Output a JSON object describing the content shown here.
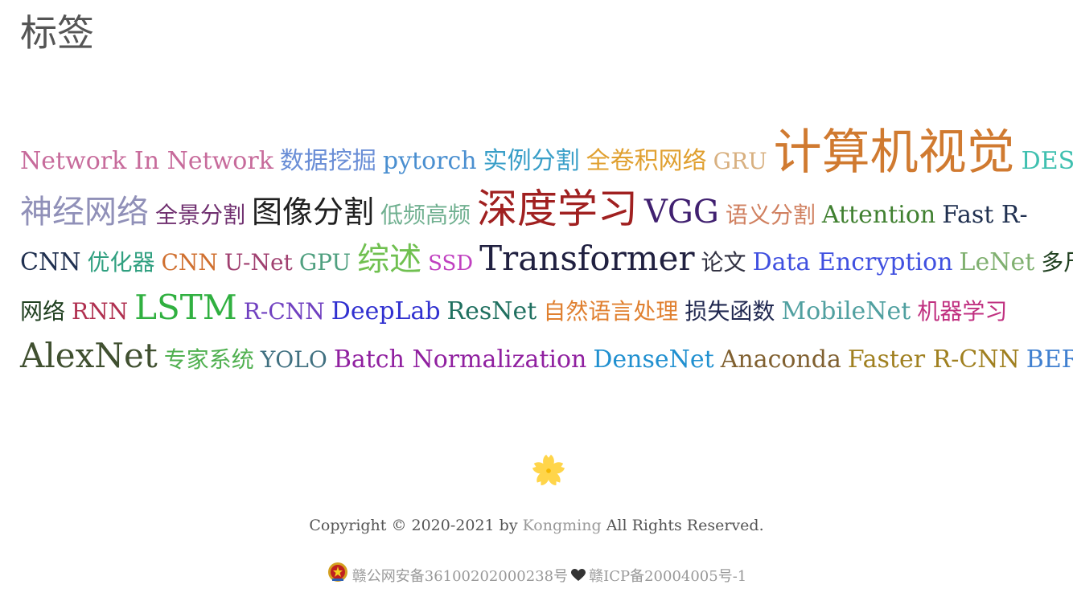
{
  "page": {
    "title": "标签"
  },
  "tags": [
    [
      {
        "label": "Network In Network",
        "size": 30,
        "color": "#c76b9b"
      },
      {
        "label": "数据挖掘",
        "size": 30,
        "color": "#6a8ed6"
      },
      {
        "label": "pytorch",
        "size": 30,
        "color": "#4a8fd0"
      },
      {
        "label": "实例分割",
        "size": 30,
        "color": "#3a9fc8"
      },
      {
        "label": "全卷积网络",
        "size": 30,
        "color": "#e0a030"
      },
      {
        "label": "GRU",
        "size": 28,
        "color": "#d8b080"
      },
      {
        "label": "计算机视觉",
        "size": 60,
        "color": "#d07a30"
      },
      {
        "label": "DES",
        "size": 30,
        "color": "#40c0b0"
      }
    ],
    [
      {
        "label": "神经网络",
        "size": 40,
        "color": "#9090b8"
      },
      {
        "label": "全景分割",
        "size": 28,
        "color": "#703070"
      },
      {
        "label": "图像分割",
        "size": 38,
        "color": "#202020"
      },
      {
        "label": "低频高频",
        "size": 28,
        "color": "#70b090"
      },
      {
        "label": "深度学习",
        "size": 50,
        "color": "#a02020"
      },
      {
        "label": "VGG",
        "size": 40,
        "color": "#402070"
      },
      {
        "label": "语义分割",
        "size": 28,
        "color": "#d08060"
      },
      {
        "label": "Attention",
        "size": 30,
        "color": "#408030"
      },
      {
        "label": "Fast R-",
        "size": 30,
        "color": "#203050"
      }
    ],
    [
      {
        "label": "CNN",
        "size": 30,
        "color": "#203050"
      },
      {
        "label": "优化器",
        "size": 28,
        "color": "#30a080"
      },
      {
        "label": "CNN",
        "size": 28,
        "color": "#d07030"
      },
      {
        "label": "U-Net",
        "size": 28,
        "color": "#a04070"
      },
      {
        "label": "GPU",
        "size": 28,
        "color": "#50a080"
      },
      {
        "label": "综述",
        "size": 40,
        "color": "#70c050"
      },
      {
        "label": "SSD",
        "size": 26,
        "color": "#c040c0"
      },
      {
        "label": "Transformer",
        "size": 42,
        "color": "#202040"
      },
      {
        "label": "论文",
        "size": 28,
        "color": "#303040"
      },
      {
        "label": "Data Encryption",
        "size": 30,
        "color": "#4050e0"
      },
      {
        "label": "LeNet",
        "size": 30,
        "color": "#80b070"
      },
      {
        "label": "多尺度",
        "size": 28,
        "color": "#204020"
      }
    ],
    [
      {
        "label": "网络",
        "size": 28,
        "color": "#204020"
      },
      {
        "label": "RNN",
        "size": 28,
        "color": "#b03050"
      },
      {
        "label": "LSTM",
        "size": 42,
        "color": "#30b040"
      },
      {
        "label": "R-CNN",
        "size": 28,
        "color": "#7040c0"
      },
      {
        "label": "DeepLab",
        "size": 30,
        "color": "#3030d0"
      },
      {
        "label": "ResNet",
        "size": 30,
        "color": "#207060"
      },
      {
        "label": "自然语言处理",
        "size": 28,
        "color": "#e08030"
      },
      {
        "label": "损失函数",
        "size": 28,
        "color": "#202850"
      },
      {
        "label": "MobileNet",
        "size": 30,
        "color": "#50a0a0"
      },
      {
        "label": "机器学习",
        "size": 28,
        "color": "#c03080"
      }
    ],
    [
      {
        "label": "AlexNet",
        "size": 42,
        "color": "#405030"
      },
      {
        "label": "专家系统",
        "size": 28,
        "color": "#50b050"
      },
      {
        "label": "YOLO",
        "size": 28,
        "color": "#407080"
      },
      {
        "label": "Batch Normalization",
        "size": 30,
        "color": "#9020a0"
      },
      {
        "label": "DenseNet",
        "size": 30,
        "color": "#2090d0"
      },
      {
        "label": "Anaconda",
        "size": 30,
        "color": "#806030"
      },
      {
        "label": "Faster R-CNN",
        "size": 30,
        "color": "#a08020"
      },
      {
        "label": "BERT",
        "size": 30,
        "color": "#4080d0"
      }
    ]
  ],
  "footer": {
    "flower_icon": "sakura-icon",
    "flower_color": "#ffd54a",
    "copyright_prefix": "Copyright © 2020-2021 by",
    "author": "Kongming",
    "copyright_suffix": "All Rights Reserved.",
    "police_record": "赣公网安备36100202000238号",
    "icp_record": "赣ICP备20004005号-1"
  }
}
